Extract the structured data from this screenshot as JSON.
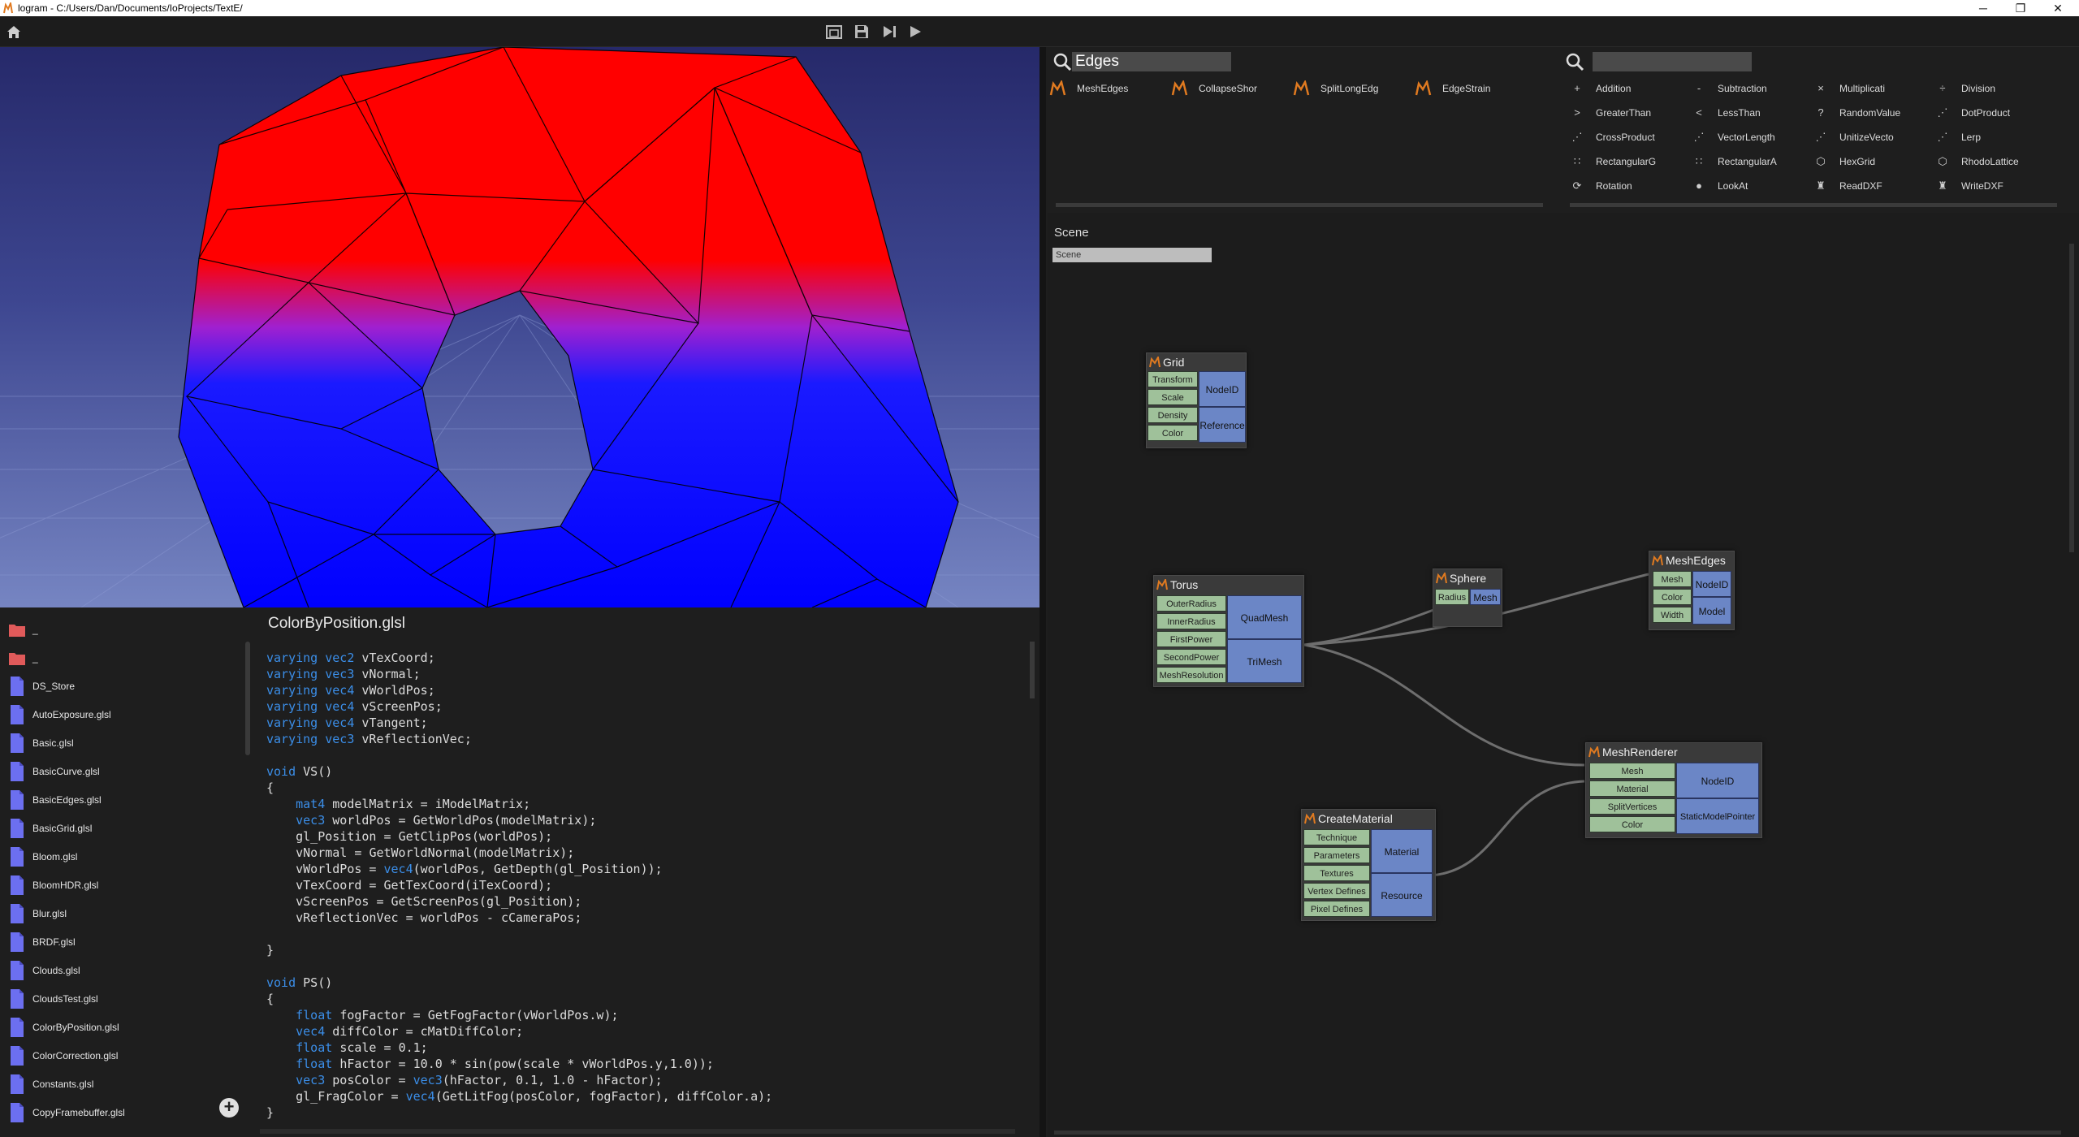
{
  "window": {
    "title": "lo",
    "title_full": "logram - C:/Users/Dan/Documents/IoProjects/TextE/",
    "min_icon": "minimize-icon",
    "max_icon": "maximize-icon",
    "close_icon": "close-icon",
    "glyph_min": "─",
    "glyph_max": "❐",
    "glyph_close": "✕"
  },
  "editor": {
    "filename": "ColorByPosition.glsl",
    "lines": [
      "varying vec2 vTexCoord;",
      "varying vec3 vNormal;",
      "varying vec4 vWorldPos;",
      "varying vec4 vScreenPos;",
      "varying vec4 vTangent;",
      "varying vec3 vReflectionVec;",
      "",
      "void VS()",
      "{",
      "    mat4 modelMatrix = iModelMatrix;",
      "    vec3 worldPos = GetWorldPos(modelMatrix);",
      "    gl_Position = GetClipPos(worldPos);",
      "    vNormal = GetWorldNormal(modelMatrix);",
      "    vWorldPos = vec4(worldPos, GetDepth(gl_Position));",
      "    vTexCoord = GetTexCoord(iTexCoord);",
      "    vScreenPos = GetScreenPos(gl_Position);",
      "    vReflectionVec = worldPos - cCameraPos;",
      "",
      "}",
      "",
      "void PS()",
      "{",
      "    float fogFactor = GetFogFactor(vWorldPos.w);",
      "    vec4 diffColor = cMatDiffColor;",
      "    float scale = 0.1;",
      "    float hFactor = 10.0 * sin(pow(scale * vWorldPos.y,1.0));",
      "    vec3 posColor = vec3(hFactor, 0.1, 1.0 - hFactor);",
      "    gl_FragColor = vec4(GetLitFog(posColor, fogFactor), diffColor.a);",
      "}"
    ],
    "keywords": [
      "varying",
      "vec2",
      "vec3",
      "vec4",
      "void",
      "float",
      "mat4"
    ]
  },
  "files": {
    "folders": [
      "_",
      "_"
    ],
    "items": [
      "DS_Store",
      "AutoExposure.glsl",
      "Basic.glsl",
      "BasicCurve.glsl",
      "BasicEdges.glsl",
      "BasicGrid.glsl",
      "Bloom.glsl",
      "BloomHDR.glsl",
      "Blur.glsl",
      "BRDF.glsl",
      "Clouds.glsl",
      "CloudsTest.glsl",
      "ColorByPosition.glsl",
      "ColorCorrection.glsl",
      "Constants.glsl",
      "CopyFramebuffer.glsl"
    ],
    "add_label": "+"
  },
  "search_left": {
    "query": "Edges",
    "results": [
      "MeshEdges",
      "CollapseShor",
      "SplitLongEdg",
      "EdgeStrain"
    ]
  },
  "search_right": {
    "query": "",
    "results": [
      [
        "Addition",
        "Subtraction",
        "Multiplicati",
        "Division"
      ],
      [
        "GreaterThan",
        "LessThan",
        "RandomValue",
        "DotProduct"
      ],
      [
        "CrossProduct",
        "VectorLength",
        "UnitizeVecto",
        "Lerp"
      ],
      [
        "RectangularG",
        "RectangularA",
        "HexGrid",
        "RhodoLattice"
      ],
      [
        "Rotation",
        "LookAt",
        "ReadDXF",
        "WriteDXF"
      ]
    ],
    "glyphs": [
      [
        "+",
        "-",
        "×",
        "÷"
      ],
      [
        ">",
        "<",
        "?",
        "⋰"
      ],
      [
        "⋰",
        "⋰",
        "⋰",
        "⋰"
      ],
      [
        "∷",
        "∷",
        "⬡",
        "⬡"
      ],
      [
        "⟳",
        "●",
        "♜",
        "♜"
      ]
    ]
  },
  "graph": {
    "scene_label": "Scene",
    "scene_input": "Scene",
    "nodes": {
      "grid": {
        "title": "Grid",
        "inputs": [
          "Transform",
          "Scale",
          "Density",
          "Color"
        ],
        "outputs": [
          "NodeID",
          "Reference"
        ]
      },
      "torus": {
        "title": "Torus",
        "inputs": [
          "OuterRadius",
          "InnerRadius",
          "FirstPower",
          "SecondPower",
          "MeshResolution"
        ],
        "outputs": [
          "QuadMesh",
          "TriMesh"
        ]
      },
      "sphere": {
        "title": "Sphere",
        "inputs": [
          "Radius"
        ],
        "outputs": [
          "Mesh"
        ]
      },
      "meshedges": {
        "title": "MeshEdges",
        "inputs": [
          "Mesh",
          "Color",
          "Width"
        ],
        "outputs": [
          "NodeID",
          "Model"
        ]
      },
      "meshrenderer": {
        "title": "MeshRenderer",
        "inputs": [
          "Mesh",
          "Material",
          "SplitVertices",
          "Color"
        ],
        "outputs": [
          "NodeID",
          "StaticModelPointer"
        ]
      },
      "creatematerial": {
        "title": "CreateMaterial",
        "inputs": [
          "Technique",
          "Parameters",
          "Textures",
          "Vertex Defines",
          "Pixel Defines"
        ],
        "outputs": [
          "Material",
          "Resource"
        ]
      }
    }
  },
  "colors": {
    "accent_blue": "#6b86c6",
    "pin_green": "#9fc19a",
    "keyword": "#3b8ee8",
    "file_icon": "#6c6ff0",
    "folder_icon": "#e05a5a"
  }
}
